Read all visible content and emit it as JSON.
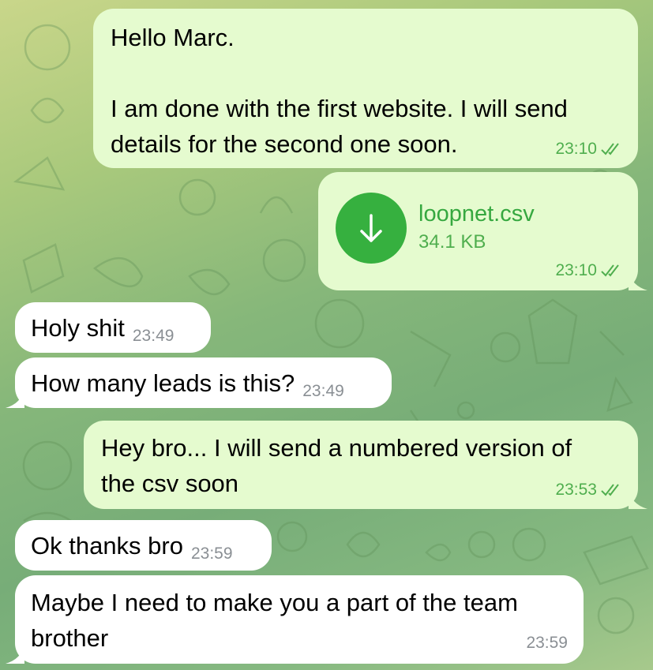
{
  "chat": {
    "messages": [
      {
        "direction": "outgoing",
        "line1": "Hello Marc.",
        "line2": "I am done with the first website. I will send",
        "line3": "details for the second one soon.",
        "time": "23:10",
        "status": "read"
      },
      {
        "direction": "outgoing",
        "type": "file",
        "file_name": "loopnet.csv",
        "file_size": "34.1 KB",
        "icon": "download-arrow-icon",
        "time": "23:10",
        "status": "read"
      },
      {
        "direction": "incoming",
        "text": "Holy shit",
        "time": "23:49"
      },
      {
        "direction": "incoming",
        "text": "How many leads is this?",
        "time": "23:49"
      },
      {
        "direction": "outgoing",
        "line1": "Hey bro... I will send a numbered version of",
        "line2": "the csv soon",
        "time": "23:53",
        "status": "read"
      },
      {
        "direction": "incoming",
        "text": "Ok thanks bro",
        "time": "23:59"
      },
      {
        "direction": "incoming",
        "line1": "Maybe I need to make you a part of the team",
        "line2": "brother",
        "time": "23:59"
      }
    ]
  },
  "colors": {
    "outgoing_bubble": "#e5fbcf",
    "incoming_bubble": "#ffffff",
    "accent_green": "#36b03f",
    "time_out": "#4fae4e",
    "time_in": "#8a8f94"
  }
}
